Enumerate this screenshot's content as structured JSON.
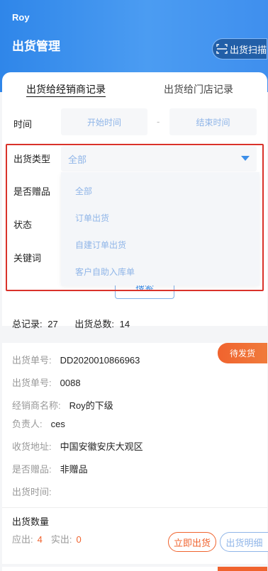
{
  "header": {
    "user_name": "Roy",
    "title": "出货管理",
    "scan_button": "出货扫描"
  },
  "tabs": [
    {
      "label": "出货给经销商记录",
      "active": true
    },
    {
      "label": "出货给门店记录",
      "active": false
    }
  ],
  "filters": {
    "time_label": "时间",
    "start_placeholder": "开始时间",
    "separator": "-",
    "end_placeholder": "结束时间",
    "type_label": "出货类型",
    "type_selected": "全部",
    "gift_label": "是否赠品",
    "status_label": "状态",
    "keyword_label": "关键词",
    "search_button": "搜索"
  },
  "type_options": [
    "全部",
    "订单出货",
    "自建订单出货",
    "客户自助入库单"
  ],
  "summary": {
    "total_label": "总记录:",
    "total_value": "27",
    "shipped_label": "出货总数:",
    "shipped_value": "14"
  },
  "order": {
    "status": "待发货",
    "fields": [
      {
        "label": "出货单号:",
        "value": "DD2020010866963"
      },
      {
        "label": "出货单号:",
        "value": "0088"
      },
      {
        "label": "经销商名称:",
        "value": "Roy的下级"
      },
      {
        "label": "负责人:",
        "value": "ces"
      },
      {
        "label": "收货地址:",
        "value": "中国安徽安庆大观区"
      },
      {
        "label": "是否赠品:",
        "value": "非赠品"
      },
      {
        "label": "出货时间:",
        "value": ""
      }
    ],
    "qty_title": "出货数量",
    "due_label": "应出:",
    "due_value": "4",
    "actual_label": "实出:",
    "actual_value": "0",
    "ship_button": "立即出货",
    "detail_button": "出货明细"
  },
  "colors": {
    "header_blue": "#3d8fe9",
    "accent_orange": "#f0632e",
    "highlight_red": "#d9322a"
  }
}
